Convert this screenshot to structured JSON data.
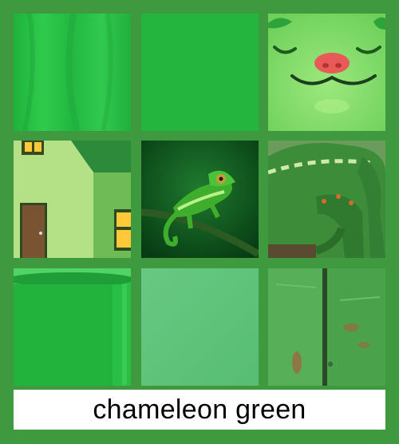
{
  "caption": "chameleon green",
  "colors": {
    "background": "#3f9a3f",
    "caption_bar": "#ffffff",
    "caption_text": "#000000"
  },
  "tiles": [
    {
      "row": 1,
      "col": 1,
      "name": "fabric-swatch",
      "color": "#27bf45"
    },
    {
      "row": 1,
      "col": 2,
      "name": "solid-green-swatch",
      "color": "#24b53f"
    },
    {
      "row": 1,
      "col": 3,
      "name": "smiling-cat-face",
      "color": "#7ddc66"
    },
    {
      "row": 2,
      "col": 1,
      "name": "green-house",
      "color": "#a8e07a"
    },
    {
      "row": 2,
      "col": 2,
      "name": "chameleon-on-branch",
      "color": "#0e5a1f"
    },
    {
      "row": 2,
      "col": 3,
      "name": "chameleon-closeup",
      "color": "#3e8a3e"
    },
    {
      "row": 3,
      "col": 1,
      "name": "green-mug",
      "color": "#22b33c"
    },
    {
      "row": 3,
      "col": 2,
      "name": "pale-green-swatch",
      "color": "#5fc379"
    },
    {
      "row": 3,
      "col": 3,
      "name": "green-wood-planks",
      "color": "#4ea84e"
    }
  ]
}
